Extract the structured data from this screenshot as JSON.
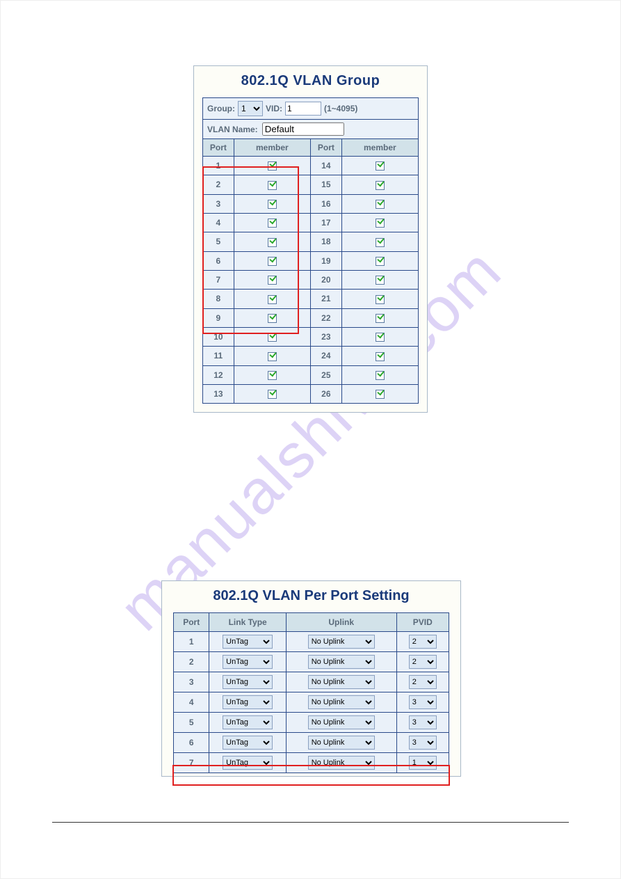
{
  "watermark": "manualshive.com",
  "panel1": {
    "title": "802.1Q VLAN Group",
    "group_label": "Group:",
    "group_value": "1",
    "vid_label": "VID:",
    "vid_value": "1",
    "vid_range": "(1~4095)",
    "vlan_name_label": "VLAN Name:",
    "vlan_name_value": "Default",
    "col_port": "Port",
    "col_member": "member",
    "left_ports": [
      "1",
      "2",
      "3",
      "4",
      "5",
      "6",
      "7",
      "8",
      "9",
      "10",
      "11",
      "12",
      "13"
    ],
    "right_ports": [
      "14",
      "15",
      "16",
      "17",
      "18",
      "19",
      "20",
      "21",
      "22",
      "23",
      "24",
      "25",
      "26"
    ]
  },
  "panel2": {
    "title": "802.1Q VLAN Per Port Setting",
    "col_port": "Port",
    "col_linktype": "Link Type",
    "col_uplink": "Uplink",
    "col_pvid": "PVID",
    "rows": [
      {
        "port": "1",
        "lt": "UnTag",
        "up": "No Uplink",
        "pvid": "2"
      },
      {
        "port": "2",
        "lt": "UnTag",
        "up": "No Uplink",
        "pvid": "2"
      },
      {
        "port": "3",
        "lt": "UnTag",
        "up": "No Uplink",
        "pvid": "2"
      },
      {
        "port": "4",
        "lt": "UnTag",
        "up": "No Uplink",
        "pvid": "3"
      },
      {
        "port": "5",
        "lt": "UnTag",
        "up": "No Uplink",
        "pvid": "3"
      },
      {
        "port": "6",
        "lt": "UnTag",
        "up": "No Uplink",
        "pvid": "3"
      },
      {
        "port": "7",
        "lt": "UnTag",
        "up": "No Uplink",
        "pvid": "1"
      }
    ]
  }
}
